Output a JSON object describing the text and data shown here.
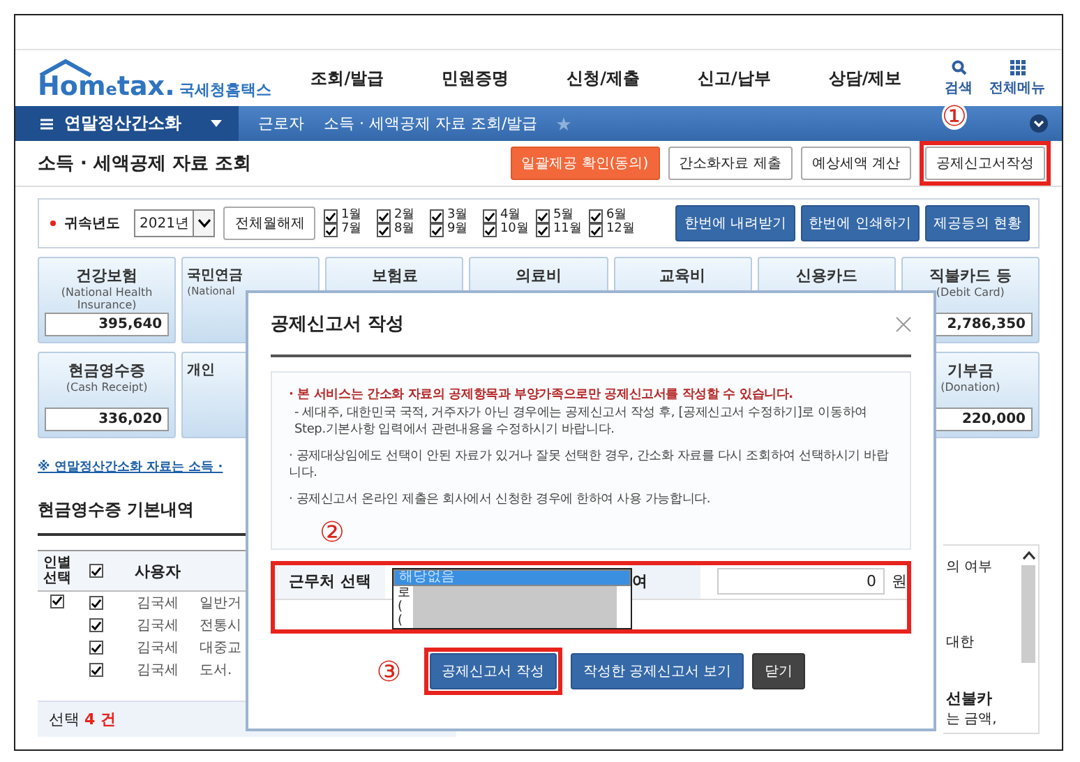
{
  "header": {
    "logo": {
      "brand_1": "Hom",
      "brand_2": "e",
      "brand_3": "tax.",
      "name": "국세청홈택스"
    },
    "nav": [
      "조회/발급",
      "민원증명",
      "신청/제출",
      "신고/납부",
      "상담/제보"
    ],
    "tools": [
      {
        "label": "검색",
        "kind": "search"
      },
      {
        "label": "전체메뉴",
        "kind": "menu"
      }
    ]
  },
  "breadcrumb": {
    "menu": "연말정산간소화",
    "items": [
      "근로자",
      "소득 · 세액공제 자료 조회/발급"
    ]
  },
  "page": {
    "title": "소득 · 세액공제 자료 조회",
    "actions": [
      {
        "label": "일괄제공 확인(동의)",
        "kind": "orange",
        "highlighted": false
      },
      {
        "label": "간소화자료 제출",
        "kind": "plain",
        "highlighted": false
      },
      {
        "label": "예상세액 계산",
        "kind": "plain",
        "highlighted": false
      },
      {
        "label": "공제신고서작성",
        "kind": "plain",
        "highlighted": true
      }
    ]
  },
  "filter": {
    "label": "귀속년도",
    "year": "2021년",
    "clear": "전체월해제",
    "months": [
      {
        "label": "1월",
        "checked": true
      },
      {
        "label": "2월",
        "checked": true
      },
      {
        "label": "3월",
        "checked": true
      },
      {
        "label": "4월",
        "checked": true
      },
      {
        "label": "5월",
        "checked": true
      },
      {
        "label": "6월",
        "checked": true
      },
      {
        "label": "7월",
        "checked": true
      },
      {
        "label": "8월",
        "checked": true
      },
      {
        "label": "9월",
        "checked": true
      },
      {
        "label": "10월",
        "checked": true
      },
      {
        "label": "11월",
        "checked": true
      },
      {
        "label": "12월",
        "checked": true
      }
    ],
    "actions": [
      "한번에 내려받기",
      "한번에 인쇄하기",
      "제공등의 현황"
    ]
  },
  "cards_row_1": [
    {
      "title": "건강보험",
      "subtitle": "(National Health Insurance)",
      "value": "395,640"
    },
    {
      "title": "국민연금",
      "subtitle": "(National"
    },
    {
      "title": "보험료"
    },
    {
      "title": "의료비"
    },
    {
      "title": "교육비"
    },
    {
      "title": "신용카드"
    },
    {
      "title": "직불카드 등",
      "subtitle": "(Debit Card)",
      "value": "2,786,350"
    }
  ],
  "cards_row_2": [
    {
      "title": "현금영수증",
      "subtitle": "(Cash Receipt)",
      "value": "336,020"
    },
    {
      "title": "개인"
    },
    {
      "title": "기부금",
      "subtitle": "(Donation)",
      "value": "220,000"
    }
  ],
  "notice_link": "※ 연말정산간소화 자료는 소득 ·",
  "section_title": "현금영수증 기본내역",
  "table": {
    "column_1": "인별 선택",
    "all_checked": true,
    "column_3": "사용자",
    "rows": [
      {
        "person_checked": true,
        "checked": true,
        "user": "김국세",
        "item": "일반거"
      },
      {
        "checked": true,
        "user": "김국세",
        "item": "전통시"
      },
      {
        "checked": true,
        "user": "김국세",
        "item": "대중교"
      },
      {
        "checked": true,
        "user": "김국세",
        "item": "도서."
      }
    ],
    "footer": {
      "label": "선택",
      "count": "4",
      "unit": "건"
    }
  },
  "side_texts": [
    {
      "text": "의 여부",
      "kind": "normal"
    },
    {
      "text": "대한",
      "kind": "normal"
    },
    {
      "text": "선불카",
      "kind": "bold"
    },
    {
      "text": "는 금액,",
      "kind": "normal"
    }
  ],
  "modal": {
    "title": "공제신고서 작성",
    "notices": [
      {
        "kind": "warning",
        "text": "· 본 서비스는 간소화 자료의 공제항목과 부양가족으로만 공제신고서를 작성할 수 있습니다.",
        "detail": "- 세대주, 대한민국 국적, 거주자가 아닌 경우에는 공제신고서 작성 후, [공제신고서 수정하기]로 이동하여 Step.기본사항 입력에서 관련내용을 수정하시기 바랍니다."
      },
      {
        "kind": "normal",
        "text": "· 공제대상임에도 선택이 안된 자료가 있거나 잘못 선택한 경우, 간소화 자료를 다시 조회하여 선택하시기 바랍니다."
      },
      {
        "kind": "normal",
        "text": "· 공제신고서 온라인 제출은 회사에서 신청한 경우에 한하여 사용 가능합니다."
      }
    ],
    "workplace": {
      "label": "근무처 선택",
      "options": [
        {
          "text": "해당없음",
          "selected": true,
          "redacted": false
        },
        {
          "text": "로",
          "selected": false,
          "redacted": true
        },
        {
          "text": "(",
          "selected": false,
          "redacted": true
        },
        {
          "text": "(",
          "selected": false,
          "redacted": true
        }
      ],
      "salary_label": "여",
      "salary_value": "0",
      "unit": "원"
    },
    "buttons": [
      {
        "label": "공제신고서 작성",
        "kind": "blue",
        "highlighted": true
      },
      {
        "label": "작성한 공제신고서 보기",
        "kind": "blue",
        "highlighted": false
      },
      {
        "label": "닫기",
        "kind": "dark",
        "highlighted": false
      }
    ]
  },
  "annotations": [
    "①",
    "②",
    "③"
  ]
}
